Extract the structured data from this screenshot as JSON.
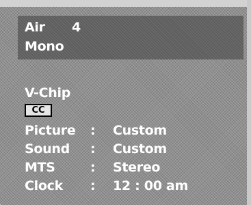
{
  "channel": {
    "source": "Air",
    "number": "4",
    "audio": "Mono"
  },
  "vchip_label": "V-Chip",
  "cc_label": "CC",
  "settings": [
    {
      "label": "Picture",
      "sep": ":",
      "value": "Custom"
    },
    {
      "label": "Sound",
      "sep": ":",
      "value": "Custom"
    },
    {
      "label": "MTS",
      "sep": ":",
      "value": "Stereo"
    },
    {
      "label": "Clock",
      "sep": ":",
      "value": "12 : 00 am"
    }
  ],
  "colors": {
    "background": "#8f8f8f",
    "channel_box": "#5e5e5e",
    "text": "#ffffff",
    "cc_badge": "#e6e6e6"
  }
}
